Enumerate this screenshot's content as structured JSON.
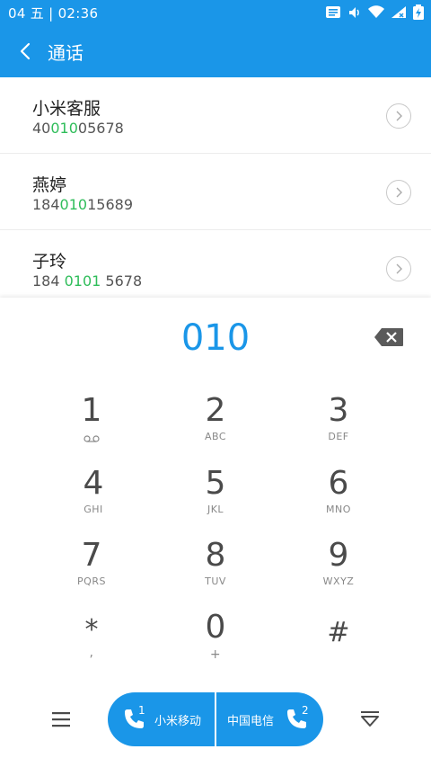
{
  "status": {
    "date": "04",
    "weekday": "五",
    "time": "02:36"
  },
  "appbar": {
    "title": "通话"
  },
  "results": [
    {
      "name": "小米客服",
      "number_pre": "40",
      "number_match": "010",
      "number_post": "05678"
    },
    {
      "name": "燕婷",
      "number_pre": "184",
      "number_match": "010",
      "number_post": "15689"
    },
    {
      "name": "子玲",
      "number_pre": "184 ",
      "number_match": "0101",
      "number_post": " 5678"
    }
  ],
  "dial": {
    "value": "010"
  },
  "keypad": [
    {
      "digit": "1",
      "letters": ""
    },
    {
      "digit": "2",
      "letters": "ABC"
    },
    {
      "digit": "3",
      "letters": "DEF"
    },
    {
      "digit": "4",
      "letters": "GHI"
    },
    {
      "digit": "5",
      "letters": "JKL"
    },
    {
      "digit": "6",
      "letters": "MNO"
    },
    {
      "digit": "7",
      "letters": "PQRS"
    },
    {
      "digit": "8",
      "letters": "TUV"
    },
    {
      "digit": "9",
      "letters": "WXYZ"
    },
    {
      "digit": "*",
      "letters": ","
    },
    {
      "digit": "0",
      "letters": "+"
    },
    {
      "digit": "#",
      "letters": ""
    }
  ],
  "calls": {
    "sim1": {
      "index": "1",
      "label": "小米移动"
    },
    "sim2": {
      "index": "2",
      "label": "中国电信"
    }
  },
  "colors": {
    "accent": "#1a96e8",
    "match": "#2fbd5a"
  },
  "icons": [
    "message-icon",
    "volume-icon",
    "wifi-icon",
    "signal-icon",
    "battery-icon",
    "back-icon",
    "chevron-right-icon",
    "backspace-icon",
    "voicemail-icon",
    "menu-icon",
    "phone-icon",
    "collapse-icon"
  ]
}
